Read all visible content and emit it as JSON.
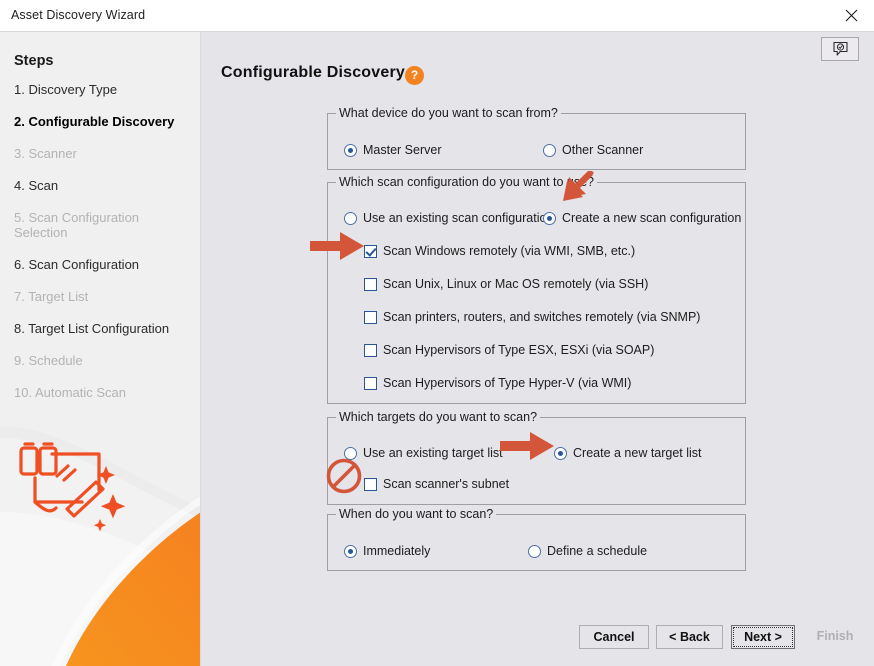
{
  "window": {
    "title": "Asset Discovery Wizard",
    "close_label": "close-icon"
  },
  "sidebar": {
    "heading": "Steps",
    "items": [
      {
        "label": "1. Discovery Type",
        "state": "normal"
      },
      {
        "label": "2. Configurable Discovery",
        "state": "active"
      },
      {
        "label": "3. Scanner",
        "state": "disabled"
      },
      {
        "label": "4. Scan",
        "state": "normal"
      },
      {
        "label": "5. Scan Configuration Selection",
        "state": "disabled"
      },
      {
        "label": "6. Scan Configuration",
        "state": "normal"
      },
      {
        "label": "7. Target List",
        "state": "disabled"
      },
      {
        "label": "8. Target List Configuration",
        "state": "normal"
      },
      {
        "label": "9. Schedule",
        "state": "disabled"
      },
      {
        "label": "10. Automatic Scan",
        "state": "disabled"
      }
    ]
  },
  "main": {
    "page_title": "Configurable Discovery",
    "help_glyph": "?",
    "feedback_icon": "feedback-bubble-icon"
  },
  "device_group": {
    "legend": "What device do you want to scan from?",
    "options": [
      {
        "label": "Master Server",
        "checked": true
      },
      {
        "label": "Other Scanner",
        "checked": false
      }
    ]
  },
  "scan_config_group": {
    "legend": "Which scan configuration do you want to use?",
    "radios": [
      {
        "label": "Use an existing scan configuration",
        "checked": false
      },
      {
        "label": "Create a new scan configuration",
        "checked": true
      }
    ],
    "checkboxes": [
      {
        "label": "Scan Windows remotely (via WMI, SMB, etc.)",
        "checked": true
      },
      {
        "label": "Scan Unix, Linux or Mac OS remotely (via SSH)",
        "checked": false
      },
      {
        "label": "Scan printers, routers, and switches remotely (via SNMP)",
        "checked": false
      },
      {
        "label": "Scan Hypervisors of Type ESX, ESXi (via SOAP)",
        "checked": false
      },
      {
        "label": "Scan Hypervisors of Type Hyper-V (via WMI)",
        "checked": false
      }
    ]
  },
  "targets_group": {
    "legend": "Which targets do you want to scan?",
    "radios": [
      {
        "label": "Use an existing target list",
        "checked": false
      },
      {
        "label": "Create a new target list",
        "checked": true
      }
    ],
    "checkboxes": [
      {
        "label": "Scan scanner's subnet",
        "checked": false
      }
    ]
  },
  "schedule_group": {
    "legend": "When do you want to scan?",
    "options": [
      {
        "label": "Immediately",
        "checked": true
      },
      {
        "label": "Define a schedule",
        "checked": false
      }
    ]
  },
  "footer": {
    "buttons": [
      {
        "label": "Cancel",
        "state": "normal"
      },
      {
        "label": "< Back",
        "state": "normal"
      },
      {
        "label": "Next >",
        "state": "focused"
      },
      {
        "label": "Finish",
        "state": "disabled"
      }
    ]
  },
  "annotations": [
    {
      "name": "arrow-down-left-to-create-new-scan-config",
      "type": "arrow-diagonal"
    },
    {
      "name": "arrow-right-to-scan-windows-remotely",
      "type": "arrow-right"
    },
    {
      "name": "arrow-right-to-create-new-target-list",
      "type": "arrow-right"
    },
    {
      "name": "prohibited-scan-scanner-subnet",
      "type": "no-entry"
    }
  ],
  "colors": {
    "accent_orange": "#f58220",
    "annotation_red": "#d4563a",
    "control_blue": "#2a5699",
    "panel_bg": "#e4e4e9",
    "sidebar_bg": "#f0f0f0"
  }
}
